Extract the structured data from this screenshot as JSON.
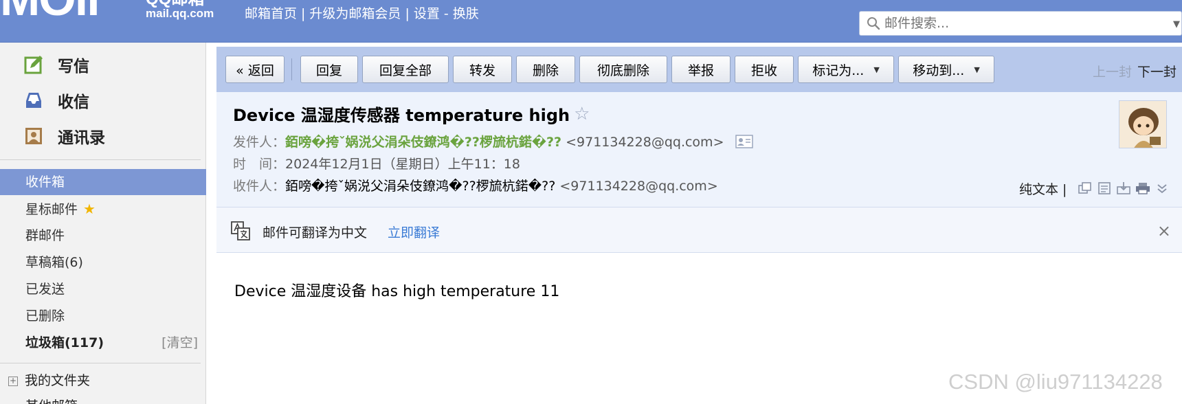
{
  "header": {
    "logo_text": "MOil",
    "brand_text": "QQ邮箱",
    "site_url": "mail.qq.com",
    "nav": {
      "home": "邮箱首页",
      "upgrade": "升级为邮箱会员",
      "settings": "设置",
      "dash": "-",
      "skin": "换肤",
      "sep": "|"
    },
    "search_placeholder": "邮件搜索..."
  },
  "sidebar": {
    "quick": [
      {
        "label": "写信",
        "icon": "compose-icon"
      },
      {
        "label": "收信",
        "icon": "inbox-tray-icon"
      },
      {
        "label": "通讯录",
        "icon": "contacts-icon"
      }
    ],
    "folders": [
      {
        "label": "收件箱",
        "active": true
      },
      {
        "label": "星标邮件",
        "star": "★"
      },
      {
        "label": "群邮件"
      },
      {
        "label": "草稿箱(6)"
      },
      {
        "label": "已发送"
      },
      {
        "label": "已删除"
      },
      {
        "label": "垃圾箱(117)",
        "bold": true,
        "clear": "[清空]"
      }
    ],
    "my_folders": "我的文件夹",
    "my_folders_toggle": "+",
    "other_boxes": "其他邮箱"
  },
  "toolbar": {
    "buttons": [
      "« 返回",
      "回复",
      "回复全部",
      "转发",
      "删除",
      "彻底删除",
      "举报",
      "拒收",
      "标记为...",
      "移动到..."
    ],
    "dropdown_glyph": "▼",
    "prev": "上一封",
    "next": "下一封"
  },
  "mail": {
    "subject": "Device 温湿度传感器 temperature high",
    "star": "☆",
    "from_label": "发件人：",
    "from_name": "銆嗙�挎ˇ娲涚父涓朵伎鐐鸿�??椤旈杭鍩�??",
    "from_addr": "<971134228@qq.com>",
    "time_label": "时　间：",
    "time_value": "2024年12月1日（星期日）上午11：18",
    "to_label": "收件人：",
    "to_name": "銆嗙�挎ˇ娲涚父涓朵伎鐐鸿�??椤旈杭鍩�??",
    "to_addr": "<971134228@qq.com>",
    "plain_text": "纯文本 |",
    "body": "Device 温湿度设备 has high temperature 11"
  },
  "translate": {
    "text": "邮件可翻译为中文",
    "link": "立即翻译",
    "close": "×"
  },
  "watermark": "CSDN @liu971134228",
  "colors": {
    "topbar": "#6b8bd0",
    "sidebar_active": "#7d97d4",
    "toolbar": "#b7c8eb",
    "sender_green": "#6aa33e",
    "link_blue": "#3a7bd5"
  }
}
